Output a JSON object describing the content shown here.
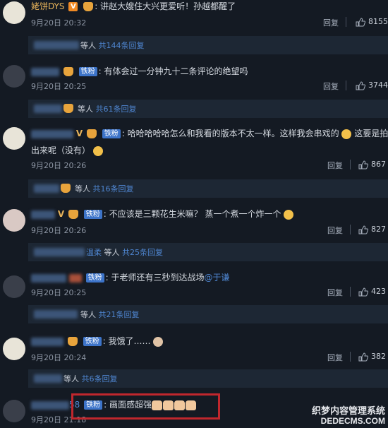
{
  "comments": [
    {
      "name": "姥饼DYS",
      "badge": "",
      "text": "讲赵大嫂住大兴更爱听！孙越都醒了",
      "text2": "",
      "time": "9月20日 20:32",
      "reply": "回复",
      "likes": "8155"
    },
    {
      "name": "",
      "badge": "铁粉",
      "text": "有体会过一分钟九十二条评论的绝望吗",
      "text2": "",
      "time": "9月20日 20:25",
      "reply": "回复",
      "likes": "3744"
    },
    {
      "name": "",
      "badge": "铁粉",
      "text": "哈哈哈哈哈怎么和我看的版本不太一样。这样我会串戏的",
      "text_tail": "这要是拍",
      "text2": "出来呢（没有）",
      "time": "9月20日 20:26",
      "reply": "回复",
      "likes": "867"
    },
    {
      "name": "",
      "badge": "铁粉",
      "text": "不应该是三颗花生米嘛？ 蒸一个煮一个炸一个",
      "text2": "",
      "time": "9月20日 20:26",
      "reply": "回复",
      "likes": "827"
    },
    {
      "name": "",
      "badge": "铁粉",
      "text": "于老师还有三秒到达战场",
      "mention": "@于谦",
      "text2": "",
      "time": "9月20日 20:25",
      "reply": "回复",
      "likes": "423"
    },
    {
      "name": "",
      "badge": "铁粉",
      "text": "我饿了……",
      "text2": "",
      "time": "9月20日 20:24",
      "reply": "回复",
      "likes": "382"
    },
    {
      "name": "58",
      "badge": "铁粉",
      "text": "画面感超强",
      "text2": "",
      "time": "9月20日 21:18",
      "reply": "",
      "likes": ""
    }
  ],
  "subreplies": [
    {
      "name_text": "",
      "text": "等人",
      "link": "共144条回复"
    },
    {
      "name_text": "",
      "text": "等人",
      "link": "共61条回复"
    },
    {
      "name_text": "",
      "text": "等人",
      "link": "共16条回复"
    },
    {
      "name_text": "温柔",
      "text": "等人",
      "link": "共25条回复"
    },
    {
      "name_text": "",
      "text": "等人",
      "link": "共21条回复"
    },
    {
      "name_text": "",
      "text": "等人",
      "link": "共6条回复"
    }
  ],
  "watermark": {
    "line1": "织梦内容管理系统",
    "line2": "DEDECMS.COM"
  },
  "colors": {
    "background": "#141a23",
    "link": "#4f86d1",
    "username": "#e7b35a",
    "highlight": "#c0272d"
  }
}
